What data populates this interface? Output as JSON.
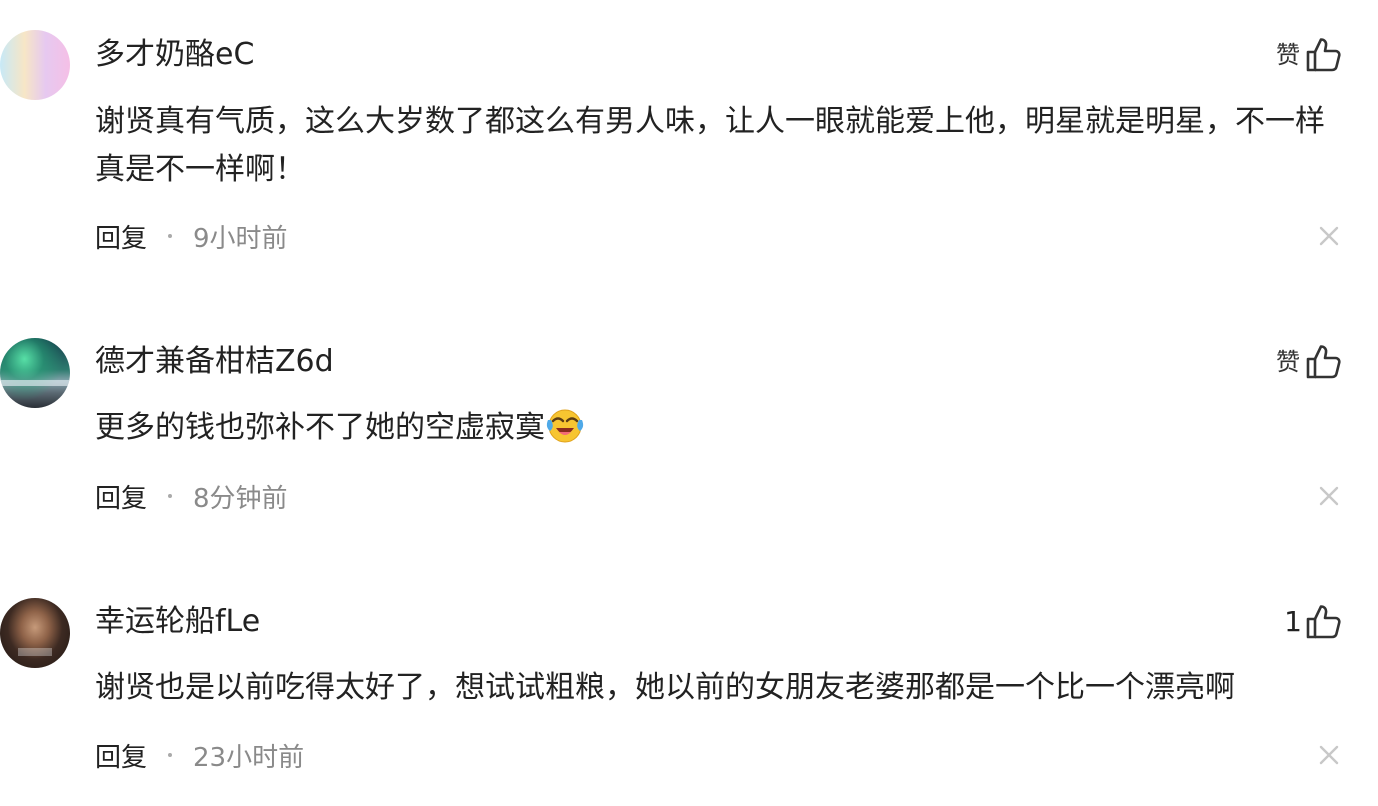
{
  "comments": [
    {
      "avatar": "gradient-avatar",
      "username": "多才奶酪eC",
      "like_label": "赞",
      "like_count": "",
      "text": "谢贤真有气质，这么大岁数了都这么有男人味，让人一眼就能爱上他，明星就是明星，不一样真是不一样啊！",
      "emoji": "",
      "reply_label": "回复",
      "time": "9小时前"
    },
    {
      "avatar": "aurora-landscape-avatar",
      "username": "德才兼备柑桔Z6d",
      "like_label": "赞",
      "like_count": "",
      "text": "更多的钱也弥补不了她的空虚寂寞",
      "emoji": "crying-laughing-emoji",
      "reply_label": "回复",
      "time": "8分钟前"
    },
    {
      "avatar": "man-portrait-avatar",
      "username": "幸运轮船fLe",
      "like_label": "",
      "like_count": "1",
      "text": "谢贤也是以前吃得太好了，想试试粗粮，她以前的女朋友老婆那都是一个比一个漂亮啊",
      "emoji": "",
      "reply_label": "回复",
      "time": "23小时前"
    }
  ],
  "icons": {
    "like": "thumbs-up-outline-icon",
    "dismiss": "close-icon"
  },
  "colors": {
    "text_primary": "#222222",
    "text_secondary": "#8a8a8a",
    "icon": "#333333",
    "dismiss": "#c8c8c8"
  }
}
